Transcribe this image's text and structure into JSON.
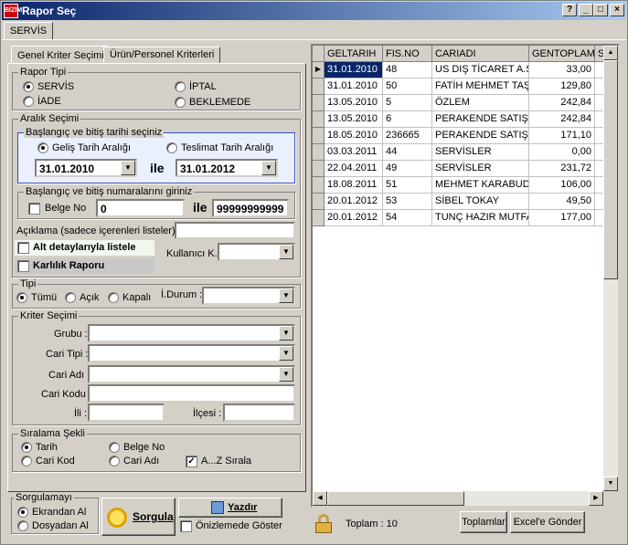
{
  "window": {
    "title": "Rapor Seç",
    "logo": "BİZİM",
    "min": "_",
    "max": "□",
    "close": "×",
    "help": "?"
  },
  "main_tab": "SERVİS",
  "tabs": [
    "Genel Kriter Seçimi",
    "Ürün/Personel Kriterleri"
  ],
  "rapor_tipi": {
    "label": "Rapor Tipi",
    "options": [
      "SERVİS",
      "İPTAL",
      "İADE",
      "BEKLEMEDE"
    ],
    "selected": "SERVİS"
  },
  "aralik": {
    "label": "Aralık Seçimi",
    "tarih_label": "Başlangıç ve bitiş tarihi seçiniz",
    "gelis": "Geliş Tarih Aralığı",
    "teslimat": "Teslimat Tarih Aralığı",
    "start": "31.01.2010",
    "end": "31.01.2012",
    "ile": "ile",
    "numara_label": "Başlangıç ve bitiş numaralarını giriniz",
    "belge_no": "Belge No",
    "num_start": "0",
    "num_end": "99999999999"
  },
  "aciklama": "Açıklama (sadece içerenleri listeler) :",
  "alt_detay": "Alt detaylarıyla listele",
  "karlilik": "Karlılık Raporu",
  "kullanici": "Kullanıcı K.:",
  "tipi": {
    "label": "Tipi",
    "options": [
      "Tümü",
      "Açık",
      "Kapalı"
    ],
    "selected": "Tümü",
    "idurum": "İ.Durum :"
  },
  "kriter": {
    "label": "Kriter Seçimi",
    "grubu": "Grubu :",
    "cari_tipi": "Cari Tipi :",
    "cari_adi": "Cari Adı :",
    "cari_kodu": "Cari Kodu",
    "ili": "İli :",
    "ilcesi": "İlçesi :"
  },
  "siralama": {
    "label": "Sıralama Şekli",
    "options": [
      "Tarih",
      "Belge No",
      "Cari Kod",
      "Cari Adı"
    ],
    "selected": "Tarih",
    "az": "A...Z Sırala"
  },
  "sorgulama": {
    "label": "Sorgulamayı",
    "options": [
      "Ekrandan Al",
      "Dosyadan Al"
    ],
    "selected": "Ekrandan Al"
  },
  "buttons": {
    "sorgula": "Sorgula",
    "yazdir": "Yazdır",
    "onizleme": "Önizlemede Göster",
    "toplamlar": "Toplamlar",
    "excel": "Excel'e Gönder"
  },
  "toplam": "Toplam : 10",
  "table": {
    "headers": [
      "GELTARIH",
      "FIS.NO",
      "CARIADI",
      "GENTOPLAM",
      "S"
    ],
    "rows": [
      [
        "31.01.2010",
        "48",
        "US DIŞ TİCARET A.Ş.",
        "33,00"
      ],
      [
        "31.01.2010",
        "50",
        "FATİH MEHMET TAŞ",
        "129,80"
      ],
      [
        "13.05.2010",
        "5",
        "ÖZLEM",
        "242,84"
      ],
      [
        "13.05.2010",
        "6",
        "PERAKENDE SATIŞI",
        "242,84"
      ],
      [
        "18.05.2010",
        "236665",
        "PERAKENDE SATIŞI",
        "171,10"
      ],
      [
        "03.03.2011",
        "44",
        "SERVİSLER",
        "0,00"
      ],
      [
        "22.04.2011",
        "49",
        "SERVİSLER",
        "231,72"
      ],
      [
        "18.08.2011",
        "51",
        "MEHMET KARABUDAK",
        "106,00"
      ],
      [
        "20.01.2012",
        "53",
        "SİBEL TOKAY",
        "49,50"
      ],
      [
        "20.01.2012",
        "54",
        "TUNÇ HAZIR MUTFAK",
        "177,00"
      ]
    ]
  }
}
